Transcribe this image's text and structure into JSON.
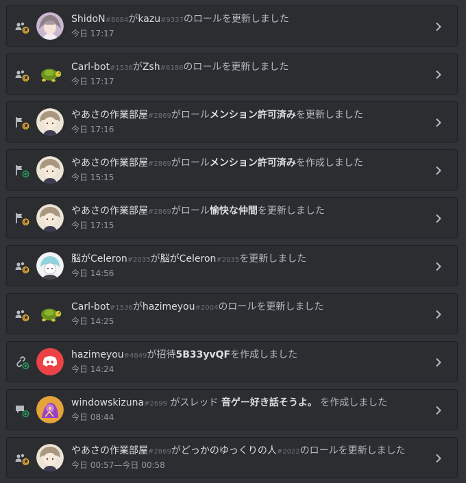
{
  "colors": {
    "background": "#313338",
    "card": "#2b2d31",
    "border": "#1e1f22",
    "text_primary": "#dbdee1",
    "text_secondary": "#b5bac1",
    "discriminator": "#6d6f78",
    "timestamp": "#949ba4",
    "update_badge": "#f0b232",
    "create_badge": "#23a559",
    "discord_blurple": "#ed4245"
  },
  "entries": [
    {
      "type_icon": "member-role-update-icon",
      "badge": "update",
      "avatar": "anime-girl-avatar",
      "parts": [
        {
          "text": "ShidoN",
          "s": "n"
        },
        {
          "text": "#8684",
          "s": "d"
        },
        {
          "text": "が",
          "s": "p"
        },
        {
          "text": "kazu",
          "s": "n"
        },
        {
          "text": "#9337",
          "s": "d"
        },
        {
          "text": "のロールを更新しました",
          "s": "p"
        }
      ],
      "time": "今日 17:17"
    },
    {
      "type_icon": "member-role-update-icon",
      "badge": "update",
      "avatar": "turtle-avatar",
      "parts": [
        {
          "text": "Carl-bot",
          "s": "n"
        },
        {
          "text": "#1536",
          "s": "d"
        },
        {
          "text": "が",
          "s": "p"
        },
        {
          "text": "Zsh",
          "s": "n"
        },
        {
          "text": "#6186",
          "s": "d"
        },
        {
          "text": "のロールを更新しました",
          "s": "p"
        }
      ],
      "time": "今日 17:17"
    },
    {
      "type_icon": "role-flag-icon",
      "badge": "update",
      "avatar": "chibi-girl-avatar",
      "parts": [
        {
          "text": "やあさの作業部屋",
          "s": "n"
        },
        {
          "text": "#2869",
          "s": "d"
        },
        {
          "text": "がロール",
          "s": "p"
        },
        {
          "text": "メンション許可済み",
          "s": "t"
        },
        {
          "text": "を更新しました",
          "s": "p"
        }
      ],
      "time": "今日 17:16"
    },
    {
      "type_icon": "role-flag-icon",
      "badge": "create",
      "avatar": "chibi-girl-avatar",
      "parts": [
        {
          "text": "やあさの作業部屋",
          "s": "n"
        },
        {
          "text": "#2869",
          "s": "d"
        },
        {
          "text": "がロール",
          "s": "p"
        },
        {
          "text": "メンション許可済み",
          "s": "t"
        },
        {
          "text": "を作成しました",
          "s": "p"
        }
      ],
      "time": "今日 15:15"
    },
    {
      "type_icon": "role-flag-icon",
      "badge": "update",
      "avatar": "chibi-girl-avatar",
      "parts": [
        {
          "text": "やあさの作業部屋",
          "s": "n"
        },
        {
          "text": "#2869",
          "s": "d"
        },
        {
          "text": "がロール",
          "s": "p"
        },
        {
          "text": "愉快な仲間",
          "s": "t"
        },
        {
          "text": "を更新しました",
          "s": "p"
        }
      ],
      "time": "今日 17:15"
    },
    {
      "type_icon": "member-update-icon",
      "badge": "update",
      "avatar": "sketch-girl-avatar",
      "parts": [
        {
          "text": "脳がCeleron",
          "s": "n"
        },
        {
          "text": "#2035",
          "s": "d"
        },
        {
          "text": "が",
          "s": "p"
        },
        {
          "text": "脳がCeleron",
          "s": "n"
        },
        {
          "text": "#2035",
          "s": "d"
        },
        {
          "text": "を更新しました",
          "s": "p"
        }
      ],
      "time": "今日 14:56"
    },
    {
      "type_icon": "member-role-update-icon",
      "badge": "update",
      "avatar": "turtle-avatar",
      "parts": [
        {
          "text": "Carl-bot",
          "s": "n"
        },
        {
          "text": "#1536",
          "s": "d"
        },
        {
          "text": "が",
          "s": "p"
        },
        {
          "text": "hazimeyou",
          "s": "n"
        },
        {
          "text": "#2004",
          "s": "d"
        },
        {
          "text": "のロールを更新しました",
          "s": "p"
        }
      ],
      "time": "今日 14:25"
    },
    {
      "type_icon": "invite-link-icon",
      "badge": "create",
      "avatar": "discord-logo-avatar",
      "parts": [
        {
          "text": "hazimeyou",
          "s": "n"
        },
        {
          "text": "#4849",
          "s": "d"
        },
        {
          "text": "が招待",
          "s": "p"
        },
        {
          "text": "5B33yvQF",
          "s": "t"
        },
        {
          "text": "を作成しました",
          "s": "p"
        }
      ],
      "time": "今日 14:24"
    },
    {
      "type_icon": "thread-icon",
      "badge": "create",
      "avatar": "purple-character-avatar",
      "parts": [
        {
          "text": "windowskizuna",
          "s": "n"
        },
        {
          "text": "#2699",
          "s": "d"
        },
        {
          "text": " がスレッド ",
          "s": "p"
        },
        {
          "text": "音ゲー好き話そうよ。",
          "s": "t"
        },
        {
          "text": " を作成しました",
          "s": "p"
        }
      ],
      "time": "今日 08:44"
    },
    {
      "type_icon": "member-role-update-icon",
      "badge": "update",
      "avatar": "chibi-girl-avatar",
      "parts": [
        {
          "text": "やあさの作業部屋",
          "s": "n"
        },
        {
          "text": "#2869",
          "s": "d"
        },
        {
          "text": "が",
          "s": "p"
        },
        {
          "text": "どっかのゆっくりの人",
          "s": "n"
        },
        {
          "text": "#2022",
          "s": "d"
        },
        {
          "text": "のロールを更新しました",
          "s": "p"
        }
      ],
      "time": "今日 00:57—今日 00:58"
    }
  ]
}
